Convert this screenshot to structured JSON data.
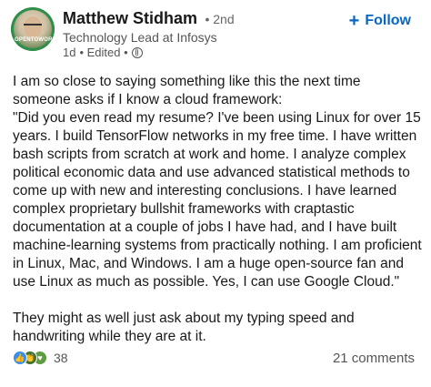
{
  "author": {
    "name": "Matthew Stidham",
    "degree": "• 2nd",
    "headline": "Technology Lead at Infosys",
    "time": "1d",
    "edited": "• Edited •",
    "visibility_icon": "globe-icon",
    "avatar_badge": "OPENTOWORK"
  },
  "follow": {
    "label": "Follow",
    "icon": "plus-icon",
    "color": "#0a66c2"
  },
  "post": {
    "para1": "I am so close to saying something like this the next time someone asks if I know a cloud framework:",
    "para2": "\"Did you even read my resume? I've been using Linux for over 15 years. I build TensorFlow networks in my free time. I have written bash scripts from scratch at work and home. I analyze complex political economic data and use advanced statistical methods to come up with new and interesting conclusions. I have learned complex proprietary bullshit frameworks with craptastic documentation at a couple of jobs I have had, and I have built machine-learning systems from practically nothing. I am proficient in Linux, Mac, and Windows. I am a huge open-source fan and use Linux as much as possible. Yes, I can use Google Cloud.\"",
    "para3": "They might as well just ask about my typing speed and handwriting while they are at it."
  },
  "social": {
    "reactions": [
      "like-icon",
      "celebrate-icon",
      "support-icon"
    ],
    "reaction_count": "38",
    "comments": "21 comments"
  }
}
